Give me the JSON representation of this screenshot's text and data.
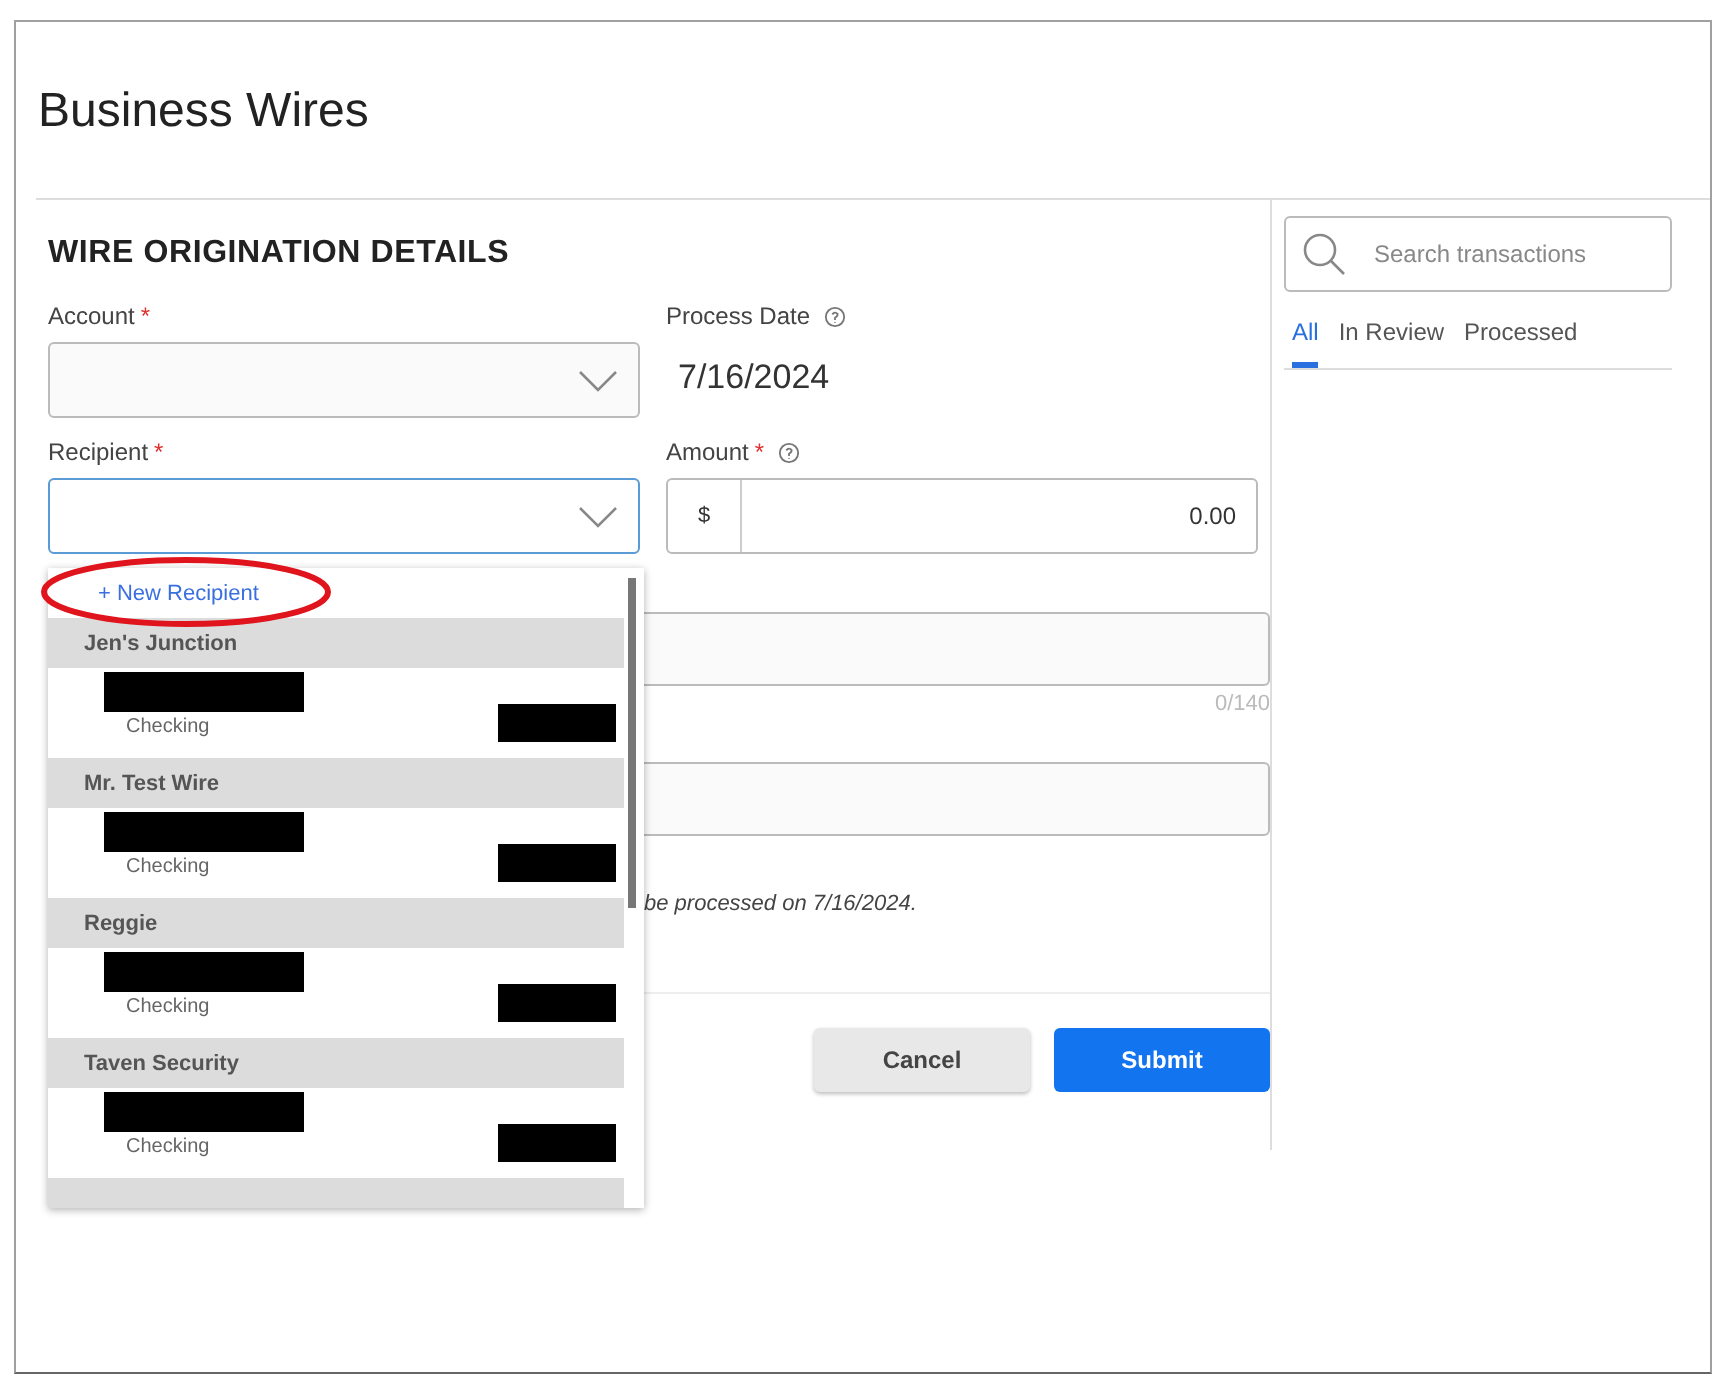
{
  "page": {
    "title": "Business Wires"
  },
  "form": {
    "heading": "WIRE ORIGINATION DETAILS",
    "account": {
      "label": "Account",
      "required_mark": "*"
    },
    "process_date": {
      "label": "Process Date",
      "value": "7/16/2024"
    },
    "recipient": {
      "label": "Recipient",
      "required_mark": "*",
      "focused": true
    },
    "amount": {
      "label": "Amount",
      "required_mark": "*",
      "prefix": "$",
      "value": "0.00"
    },
    "memo_counter": "0/140",
    "note": "be processed on 7/16/2024.",
    "buttons": [
      {
        "label": "Cancel",
        "kind": "secondary"
      },
      {
        "label": "Submit",
        "kind": "primary"
      }
    ]
  },
  "recipient_dropdown": {
    "new_item": "+ New Recipient",
    "groups": [
      {
        "name": "Jen's Junction",
        "accounts": [
          {
            "type": "Checking"
          }
        ]
      },
      {
        "name": "Mr. Test Wire",
        "accounts": [
          {
            "type": "Checking"
          }
        ]
      },
      {
        "name": "Reggie",
        "accounts": [
          {
            "type": "Checking"
          }
        ]
      },
      {
        "name": "Taven Security",
        "accounts": [
          {
            "type": "Checking"
          }
        ]
      }
    ]
  },
  "sidebar": {
    "search": {
      "placeholder": "Search transactions"
    },
    "tabs": [
      {
        "label": "All",
        "selected": true
      },
      {
        "label": "In Review",
        "selected": false
      },
      {
        "label": "Processed",
        "selected": false
      }
    ]
  }
}
